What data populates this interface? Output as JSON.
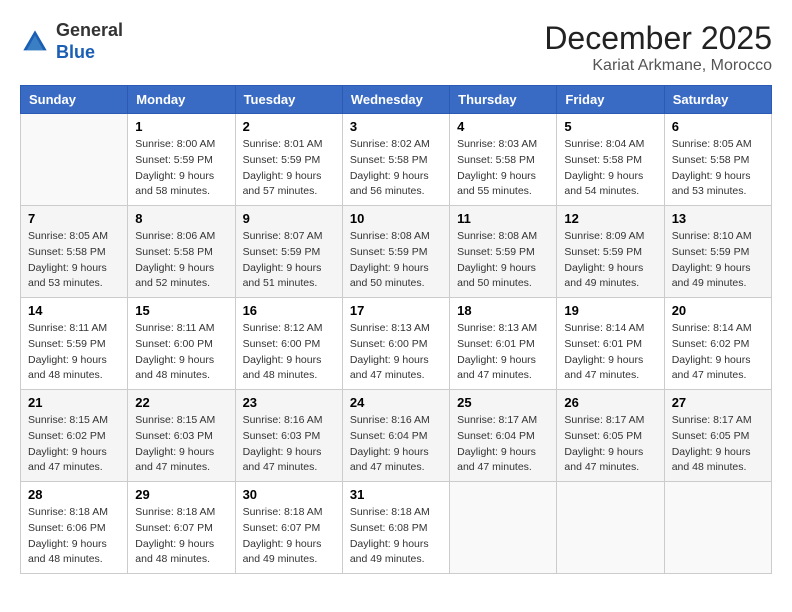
{
  "header": {
    "logo_general": "General",
    "logo_blue": "Blue",
    "month_year": "December 2025",
    "location": "Kariat Arkmane, Morocco"
  },
  "columns": [
    "Sunday",
    "Monday",
    "Tuesday",
    "Wednesday",
    "Thursday",
    "Friday",
    "Saturday"
  ],
  "weeks": [
    [
      {
        "day": "",
        "info": ""
      },
      {
        "day": "1",
        "info": "Sunrise: 8:00 AM\nSunset: 5:59 PM\nDaylight: 9 hours\nand 58 minutes."
      },
      {
        "day": "2",
        "info": "Sunrise: 8:01 AM\nSunset: 5:59 PM\nDaylight: 9 hours\nand 57 minutes."
      },
      {
        "day": "3",
        "info": "Sunrise: 8:02 AM\nSunset: 5:58 PM\nDaylight: 9 hours\nand 56 minutes."
      },
      {
        "day": "4",
        "info": "Sunrise: 8:03 AM\nSunset: 5:58 PM\nDaylight: 9 hours\nand 55 minutes."
      },
      {
        "day": "5",
        "info": "Sunrise: 8:04 AM\nSunset: 5:58 PM\nDaylight: 9 hours\nand 54 minutes."
      },
      {
        "day": "6",
        "info": "Sunrise: 8:05 AM\nSunset: 5:58 PM\nDaylight: 9 hours\nand 53 minutes."
      }
    ],
    [
      {
        "day": "7",
        "info": "Sunrise: 8:05 AM\nSunset: 5:58 PM\nDaylight: 9 hours\nand 53 minutes."
      },
      {
        "day": "8",
        "info": "Sunrise: 8:06 AM\nSunset: 5:58 PM\nDaylight: 9 hours\nand 52 minutes."
      },
      {
        "day": "9",
        "info": "Sunrise: 8:07 AM\nSunset: 5:59 PM\nDaylight: 9 hours\nand 51 minutes."
      },
      {
        "day": "10",
        "info": "Sunrise: 8:08 AM\nSunset: 5:59 PM\nDaylight: 9 hours\nand 50 minutes."
      },
      {
        "day": "11",
        "info": "Sunrise: 8:08 AM\nSunset: 5:59 PM\nDaylight: 9 hours\nand 50 minutes."
      },
      {
        "day": "12",
        "info": "Sunrise: 8:09 AM\nSunset: 5:59 PM\nDaylight: 9 hours\nand 49 minutes."
      },
      {
        "day": "13",
        "info": "Sunrise: 8:10 AM\nSunset: 5:59 PM\nDaylight: 9 hours\nand 49 minutes."
      }
    ],
    [
      {
        "day": "14",
        "info": "Sunrise: 8:11 AM\nSunset: 5:59 PM\nDaylight: 9 hours\nand 48 minutes."
      },
      {
        "day": "15",
        "info": "Sunrise: 8:11 AM\nSunset: 6:00 PM\nDaylight: 9 hours\nand 48 minutes."
      },
      {
        "day": "16",
        "info": "Sunrise: 8:12 AM\nSunset: 6:00 PM\nDaylight: 9 hours\nand 48 minutes."
      },
      {
        "day": "17",
        "info": "Sunrise: 8:13 AM\nSunset: 6:00 PM\nDaylight: 9 hours\nand 47 minutes."
      },
      {
        "day": "18",
        "info": "Sunrise: 8:13 AM\nSunset: 6:01 PM\nDaylight: 9 hours\nand 47 minutes."
      },
      {
        "day": "19",
        "info": "Sunrise: 8:14 AM\nSunset: 6:01 PM\nDaylight: 9 hours\nand 47 minutes."
      },
      {
        "day": "20",
        "info": "Sunrise: 8:14 AM\nSunset: 6:02 PM\nDaylight: 9 hours\nand 47 minutes."
      }
    ],
    [
      {
        "day": "21",
        "info": "Sunrise: 8:15 AM\nSunset: 6:02 PM\nDaylight: 9 hours\nand 47 minutes."
      },
      {
        "day": "22",
        "info": "Sunrise: 8:15 AM\nSunset: 6:03 PM\nDaylight: 9 hours\nand 47 minutes."
      },
      {
        "day": "23",
        "info": "Sunrise: 8:16 AM\nSunset: 6:03 PM\nDaylight: 9 hours\nand 47 minutes."
      },
      {
        "day": "24",
        "info": "Sunrise: 8:16 AM\nSunset: 6:04 PM\nDaylight: 9 hours\nand 47 minutes."
      },
      {
        "day": "25",
        "info": "Sunrise: 8:17 AM\nSunset: 6:04 PM\nDaylight: 9 hours\nand 47 minutes."
      },
      {
        "day": "26",
        "info": "Sunrise: 8:17 AM\nSunset: 6:05 PM\nDaylight: 9 hours\nand 47 minutes."
      },
      {
        "day": "27",
        "info": "Sunrise: 8:17 AM\nSunset: 6:05 PM\nDaylight: 9 hours\nand 48 minutes."
      }
    ],
    [
      {
        "day": "28",
        "info": "Sunrise: 8:18 AM\nSunset: 6:06 PM\nDaylight: 9 hours\nand 48 minutes."
      },
      {
        "day": "29",
        "info": "Sunrise: 8:18 AM\nSunset: 6:07 PM\nDaylight: 9 hours\nand 48 minutes."
      },
      {
        "day": "30",
        "info": "Sunrise: 8:18 AM\nSunset: 6:07 PM\nDaylight: 9 hours\nand 49 minutes."
      },
      {
        "day": "31",
        "info": "Sunrise: 8:18 AM\nSunset: 6:08 PM\nDaylight: 9 hours\nand 49 minutes."
      },
      {
        "day": "",
        "info": ""
      },
      {
        "day": "",
        "info": ""
      },
      {
        "day": "",
        "info": ""
      }
    ]
  ]
}
